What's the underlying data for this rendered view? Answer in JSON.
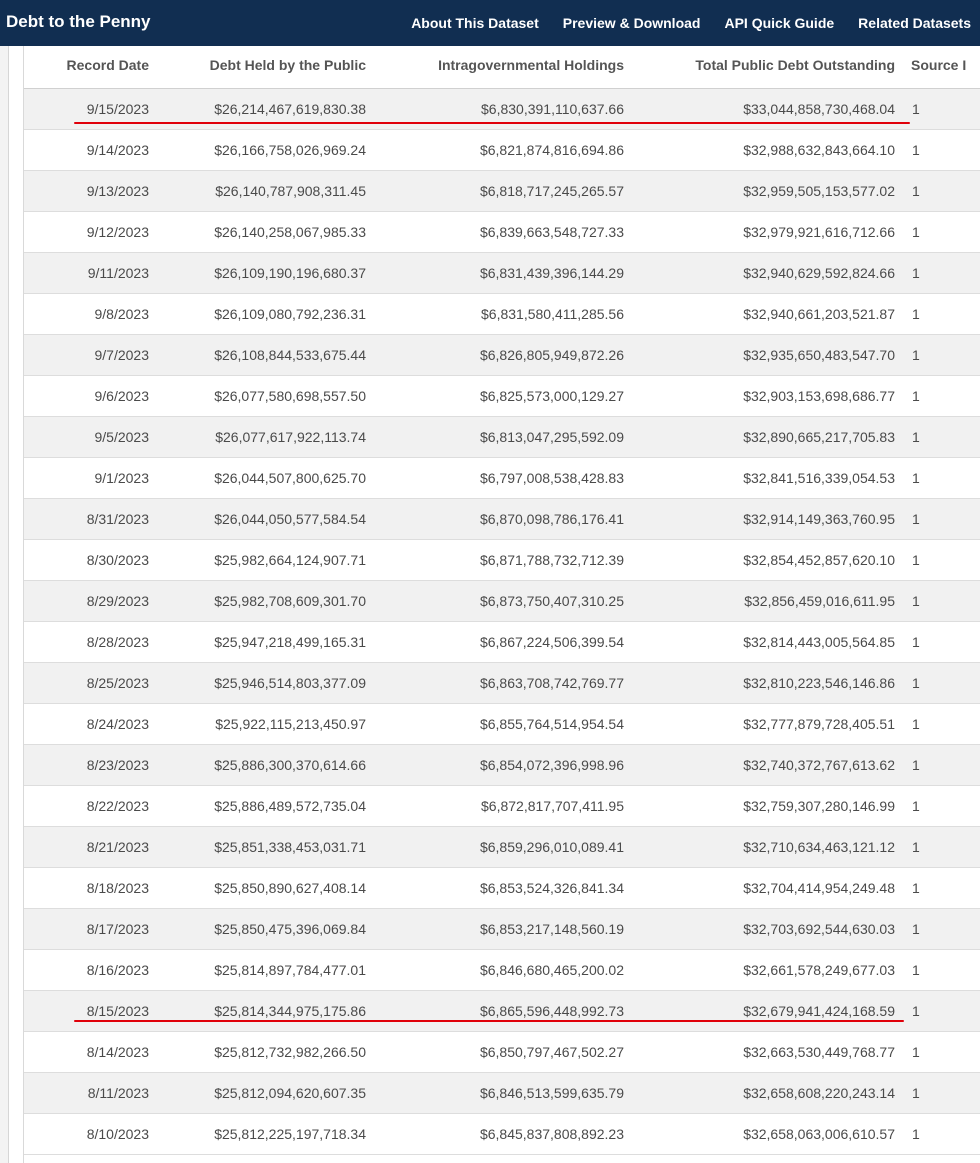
{
  "header": {
    "title": "Debt to the Penny",
    "nav": [
      "About This Dataset",
      "Preview & Download",
      "API Quick Guide",
      "Related Datasets"
    ]
  },
  "table": {
    "columns": [
      "Record Date",
      "Debt Held by the Public",
      "Intragovernmental Holdings",
      "Total Public Debt Outstanding",
      "Source I"
    ],
    "rows": [
      [
        "9/15/2023",
        "$26,214,467,619,830.38",
        "$6,830,391,110,637.66",
        "$33,044,858,730,468.04",
        "1"
      ],
      [
        "9/14/2023",
        "$26,166,758,026,969.24",
        "$6,821,874,816,694.86",
        "$32,988,632,843,664.10",
        "1"
      ],
      [
        "9/13/2023",
        "$26,140,787,908,311.45",
        "$6,818,717,245,265.57",
        "$32,959,505,153,577.02",
        "1"
      ],
      [
        "9/12/2023",
        "$26,140,258,067,985.33",
        "$6,839,663,548,727.33",
        "$32,979,921,616,712.66",
        "1"
      ],
      [
        "9/11/2023",
        "$26,109,190,196,680.37",
        "$6,831,439,396,144.29",
        "$32,940,629,592,824.66",
        "1"
      ],
      [
        "9/8/2023",
        "$26,109,080,792,236.31",
        "$6,831,580,411,285.56",
        "$32,940,661,203,521.87",
        "1"
      ],
      [
        "9/7/2023",
        "$26,108,844,533,675.44",
        "$6,826,805,949,872.26",
        "$32,935,650,483,547.70",
        "1"
      ],
      [
        "9/6/2023",
        "$26,077,580,698,557.50",
        "$6,825,573,000,129.27",
        "$32,903,153,698,686.77",
        "1"
      ],
      [
        "9/5/2023",
        "$26,077,617,922,113.74",
        "$6,813,047,295,592.09",
        "$32,890,665,217,705.83",
        "1"
      ],
      [
        "9/1/2023",
        "$26,044,507,800,625.70",
        "$6,797,008,538,428.83",
        "$32,841,516,339,054.53",
        "1"
      ],
      [
        "8/31/2023",
        "$26,044,050,577,584.54",
        "$6,870,098,786,176.41",
        "$32,914,149,363,760.95",
        "1"
      ],
      [
        "8/30/2023",
        "$25,982,664,124,907.71",
        "$6,871,788,732,712.39",
        "$32,854,452,857,620.10",
        "1"
      ],
      [
        "8/29/2023",
        "$25,982,708,609,301.70",
        "$6,873,750,407,310.25",
        "$32,856,459,016,611.95",
        "1"
      ],
      [
        "8/28/2023",
        "$25,947,218,499,165.31",
        "$6,867,224,506,399.54",
        "$32,814,443,005,564.85",
        "1"
      ],
      [
        "8/25/2023",
        "$25,946,514,803,377.09",
        "$6,863,708,742,769.77",
        "$32,810,223,546,146.86",
        "1"
      ],
      [
        "8/24/2023",
        "$25,922,115,213,450.97",
        "$6,855,764,514,954.54",
        "$32,777,879,728,405.51",
        "1"
      ],
      [
        "8/23/2023",
        "$25,886,300,370,614.66",
        "$6,854,072,396,998.96",
        "$32,740,372,767,613.62",
        "1"
      ],
      [
        "8/22/2023",
        "$25,886,489,572,735.04",
        "$6,872,817,707,411.95",
        "$32,759,307,280,146.99",
        "1"
      ],
      [
        "8/21/2023",
        "$25,851,338,453,031.71",
        "$6,859,296,010,089.41",
        "$32,710,634,463,121.12",
        "1"
      ],
      [
        "8/18/2023",
        "$25,850,890,627,408.14",
        "$6,853,524,326,841.34",
        "$32,704,414,954,249.48",
        "1"
      ],
      [
        "8/17/2023",
        "$25,850,475,396,069.84",
        "$6,853,217,148,560.19",
        "$32,703,692,544,630.03",
        "1"
      ],
      [
        "8/16/2023",
        "$25,814,897,784,477.01",
        "$6,846,680,465,200.02",
        "$32,661,578,249,677.03",
        "1"
      ],
      [
        "8/15/2023",
        "$25,814,344,975,175.86",
        "$6,865,596,448,992.73",
        "$32,679,941,424,168.59",
        "1"
      ],
      [
        "8/14/2023",
        "$25,812,732,982,266.50",
        "$6,850,797,467,502.27",
        "$32,663,530,449,768.77",
        "1"
      ],
      [
        "8/11/2023",
        "$25,812,094,620,607.35",
        "$6,846,513,599,635.79",
        "$32,658,608,220,243.14",
        "1"
      ],
      [
        "8/10/2023",
        "$25,812,225,197,718.34",
        "$6,845,837,808,892.23",
        "$32,658,063,006,610.57",
        "1"
      ]
    ]
  },
  "annotations": {
    "underline_color": "#e0000a",
    "underlined_dates": [
      "9/15/2023",
      "8/15/2023"
    ]
  }
}
